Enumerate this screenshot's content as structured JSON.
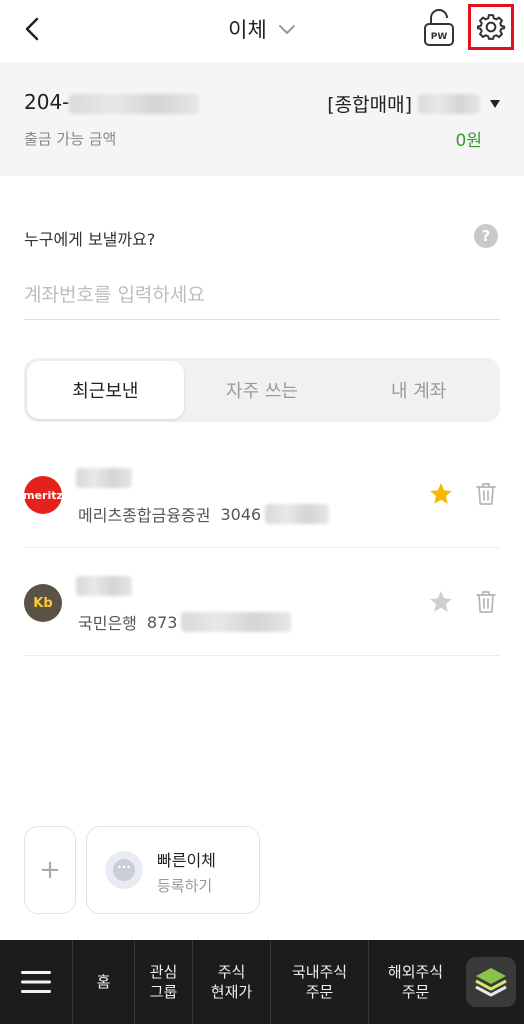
{
  "header": {
    "title": "이체",
    "pw_label": "PW"
  },
  "account": {
    "number_prefix": "204-",
    "type_label": "[종합매매]",
    "available_label": "출금 가능 금액",
    "available_value": "0원"
  },
  "recipient": {
    "question": "누구에게 보낼까요?",
    "help_symbol": "?",
    "input_placeholder": "계좌번호를 입력하세요",
    "input_value": ""
  },
  "tabs": [
    {
      "label": "최근보낸",
      "active": true
    },
    {
      "label": "자주 쓰는",
      "active": false
    },
    {
      "label": "내 계좌",
      "active": false
    }
  ],
  "recent_list": [
    {
      "logo_text": "meritz",
      "bank": "메리츠종합금융증권",
      "account_prefix": "3046",
      "favorite": true
    },
    {
      "logo_text": "Kb",
      "bank": "국민은행",
      "account_prefix": "873",
      "favorite": false
    }
  ],
  "quick_transfer": {
    "plus_symbol": "+",
    "title": "빠른이체",
    "subtitle": "등록하기"
  },
  "bottom_nav": {
    "items": [
      {
        "label": "홈"
      },
      {
        "label": "관심\n그룹"
      },
      {
        "label": "주식\n현재가"
      },
      {
        "label": "국내주식\n주문"
      },
      {
        "label": "해외주식\n주문"
      }
    ]
  },
  "colors": {
    "accent_green": "#3a9a2d",
    "highlight_red": "#e1121b",
    "star_active": "#f5b800",
    "meritz_red": "#e5211c",
    "kb_brown": "#5a5244"
  }
}
